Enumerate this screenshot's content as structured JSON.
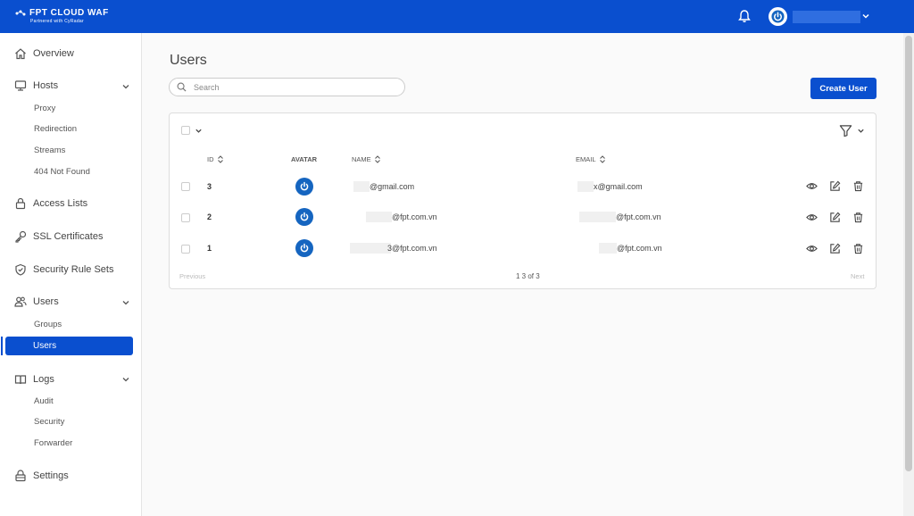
{
  "brand": {
    "name": "FPT CLOUD  WAF",
    "tagline": "Partnered with CyRadar"
  },
  "header": {
    "bell_icon": "bell-icon",
    "avatar_icon": "power-icon",
    "user_menu_icon": "chevron-down-icon"
  },
  "sidebar": {
    "overview": "Overview",
    "hosts": "Hosts",
    "hosts_sub": [
      "Proxy",
      "Redirection",
      "Streams",
      "404 Not Found"
    ],
    "access_lists": "Access Lists",
    "ssl": "SSL Certificates",
    "security_rules": "Security Rule Sets",
    "users": "Users",
    "users_sub_groups": "Groups",
    "users_sub_active": "Users",
    "logs": "Logs",
    "logs_sub": [
      "Audit",
      "Security",
      "Forwarder"
    ],
    "settings": "Settings"
  },
  "page": {
    "title": "Users",
    "search_placeholder": "Search",
    "create_button": "Create User"
  },
  "table": {
    "columns": {
      "id": "ID",
      "avatar": "AVATAR",
      "name": "NAME",
      "email": "EMAIL"
    },
    "rows": [
      {
        "id": "3",
        "name": "@gmail.com",
        "email": "x@gmail.com"
      },
      {
        "id": "2",
        "name": "@fpt.com.vn",
        "email": "@fpt.com.vn"
      },
      {
        "id": "1",
        "name": "3@fpt.com.vn",
        "email": "@fpt.com.vn"
      }
    ],
    "pagination": {
      "previous": "Previous",
      "info": "1 3 of 3",
      "next": "Next"
    }
  },
  "colors": {
    "primary": "#0a4fcf",
    "avatar": "#1565c0"
  }
}
